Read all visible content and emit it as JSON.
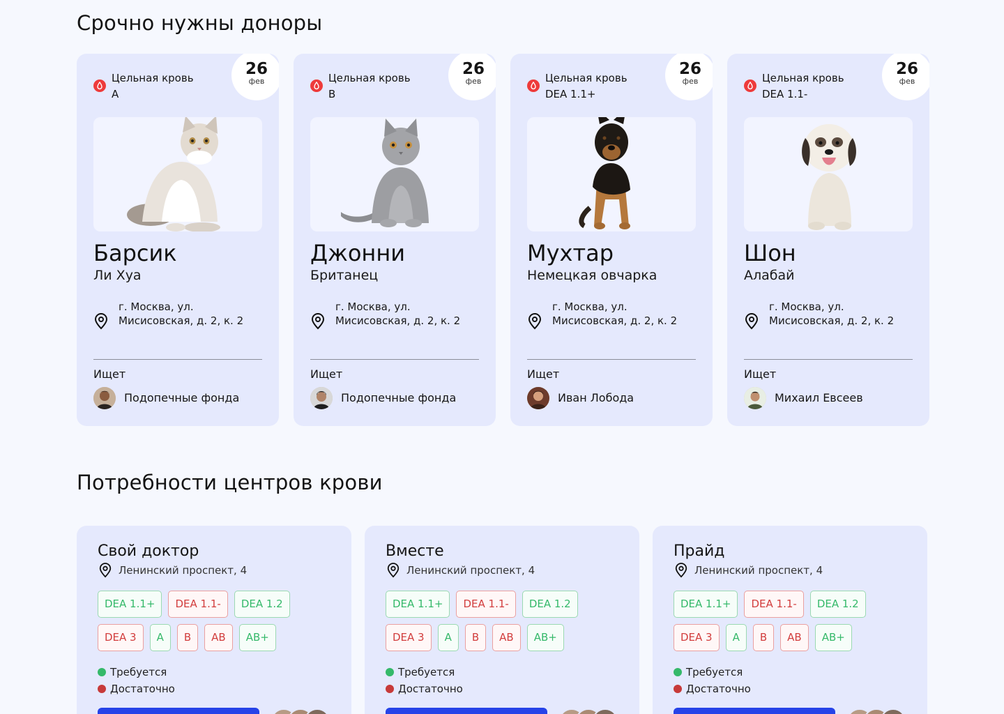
{
  "sections": {
    "donors_title": "Срочно нужны доноры",
    "centers_title": "Потребности центров крови"
  },
  "donor_cards": [
    {
      "blood_line1": "Цельная кровь",
      "blood_line2": "A",
      "date_day": "26",
      "date_month": "фев",
      "name": "Барсик",
      "breed": "Ли Хуа",
      "address": "г. Москва, ул. Мисисовская, д. 2, к. 2",
      "seeking_label": "Ищет",
      "owner": "Подопечные фонда",
      "photo_icon": "fluffy-white-cat"
    },
    {
      "blood_line1": "Цельная кровь",
      "blood_line2": "B",
      "date_day": "26",
      "date_month": "фев",
      "name": "Джонни",
      "breed": "Британец",
      "address": "г. Москва, ул. Мисисовская, д. 2, к. 2",
      "seeking_label": "Ищет",
      "owner": "Подопечные фонда",
      "photo_icon": "grey-british-cat"
    },
    {
      "blood_line1": "Цельная кровь",
      "blood_line2": "DEA 1.1+",
      "date_day": "26",
      "date_month": "фев",
      "name": "Мухтар",
      "breed": "Немецкая овчарка",
      "address": "г. Москва, ул. Мисисовская, д. 2, к. 2",
      "seeking_label": "Ищет",
      "owner": "Иван Лобода",
      "photo_icon": "german-shepherd-puppy"
    },
    {
      "blood_line1": "Цельная кровь",
      "blood_line2": "DEA 1.1-",
      "date_day": "26",
      "date_month": "фев",
      "name": "Шон",
      "breed": "Алабай",
      "address": "г. Москва, ул. Мисисовская, д. 2, к. 2",
      "seeking_label": "Ищет",
      "owner": "Михаил Евсеев",
      "photo_icon": "white-alabai-puppy"
    }
  ],
  "center_cards": [
    {
      "name": "Свой доктор",
      "address": "Ленинский проспект, 4",
      "tags_row1": [
        {
          "label": "DEA 1.1+",
          "status": "ok"
        },
        {
          "label": "DEA 1.1-",
          "status": "bad"
        },
        {
          "label": "DEA 1.2",
          "status": "ok"
        }
      ],
      "tags_row2": [
        {
          "label": "DEA 3",
          "status": "bad"
        },
        {
          "label": "A",
          "status": "ok"
        },
        {
          "label": "B",
          "status": "bad"
        },
        {
          "label": "AB",
          "status": "bad"
        },
        {
          "label": "AB+",
          "status": "ok"
        }
      ],
      "legend_required": "Требуется",
      "legend_enough": "Достаточно"
    },
    {
      "name": "Вместе",
      "address": "Ленинский проспект, 4",
      "tags_row1": [
        {
          "label": "DEA 1.1+",
          "status": "ok"
        },
        {
          "label": "DEA 1.1-",
          "status": "bad"
        },
        {
          "label": "DEA 1.2",
          "status": "ok"
        }
      ],
      "tags_row2": [
        {
          "label": "DEA 3",
          "status": "bad"
        },
        {
          "label": "A",
          "status": "ok"
        },
        {
          "label": "B",
          "status": "bad"
        },
        {
          "label": "AB",
          "status": "bad"
        },
        {
          "label": "AB+",
          "status": "ok"
        }
      ],
      "legend_required": "Требуется",
      "legend_enough": "Достаточно"
    },
    {
      "name": "Прайд",
      "address": "Ленинский проспект, 4",
      "tags_row1": [
        {
          "label": "DEA 1.1+",
          "status": "ok"
        },
        {
          "label": "DEA 1.1-",
          "status": "bad"
        },
        {
          "label": "DEA 1.2",
          "status": "ok"
        }
      ],
      "tags_row2": [
        {
          "label": "DEA 3",
          "status": "bad"
        },
        {
          "label": "A",
          "status": "ok"
        },
        {
          "label": "B",
          "status": "bad"
        },
        {
          "label": "AB",
          "status": "bad"
        },
        {
          "label": "AB+",
          "status": "ok"
        }
      ],
      "legend_required": "Требуется",
      "legend_enough": "Достаточно"
    }
  ],
  "colors": {
    "card_bg": "#e5e9fd",
    "page_bg": "#f6f8fe",
    "required_green": "#35b96a",
    "enough_red": "#d23d3d",
    "blood_icon_red": "#ee3b3b",
    "primary_button": "#2643e8"
  },
  "icons": {
    "blood": "blood-drop-icon",
    "location": "location-pin-icon"
  }
}
